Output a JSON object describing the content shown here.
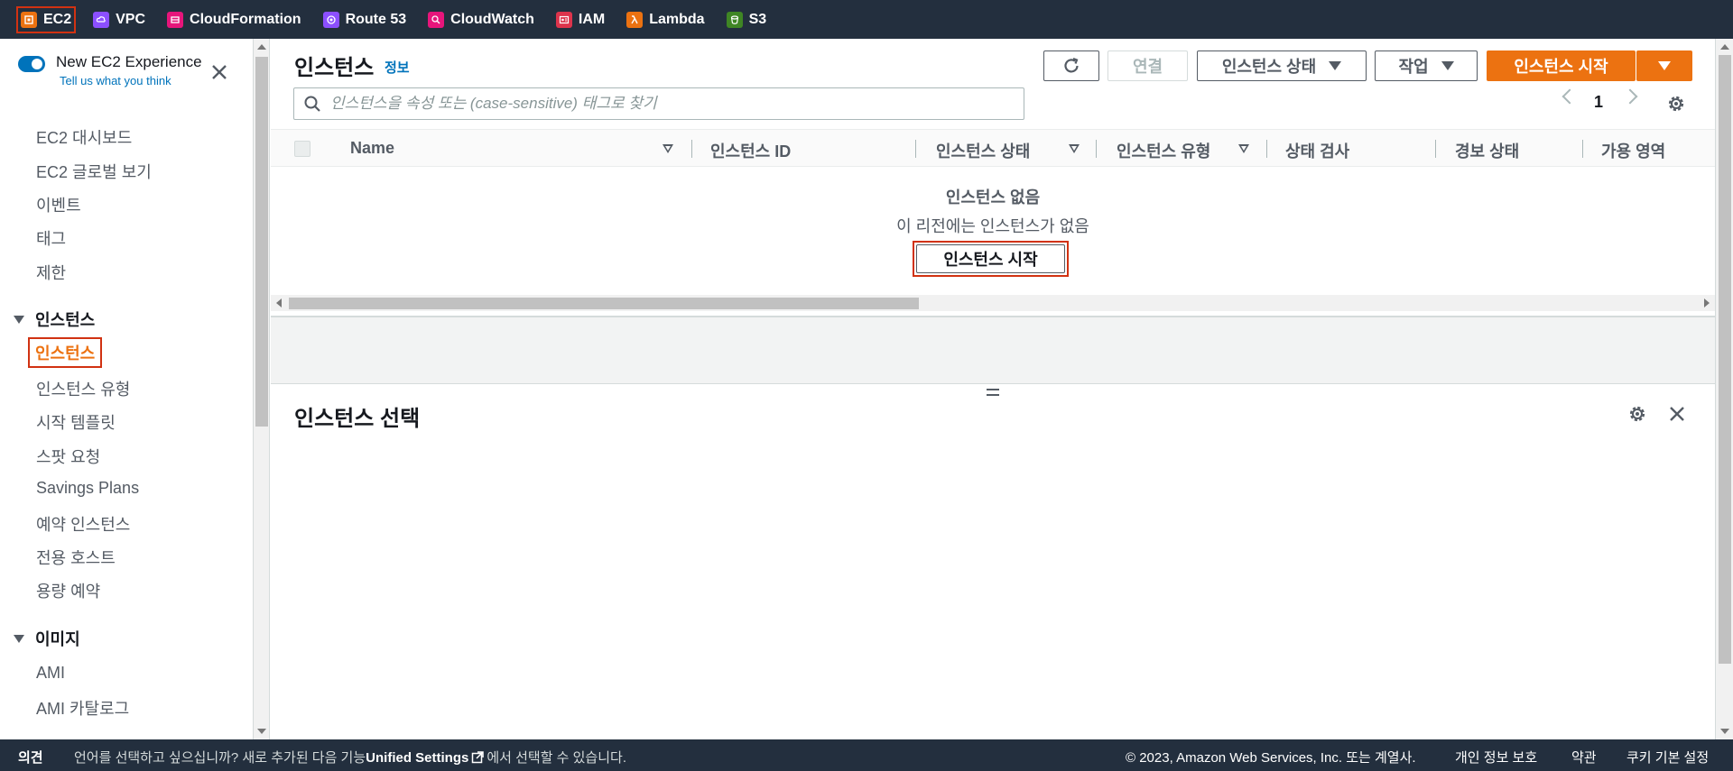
{
  "services": [
    {
      "label": "EC2",
      "icon": "ec2-icon",
      "color": "#ec7211"
    },
    {
      "label": "VPC",
      "icon": "vpc-icon",
      "color": "#8c4fff"
    },
    {
      "label": "CloudFormation",
      "icon": "cloudformation-icon",
      "color": "#e7157b"
    },
    {
      "label": "Route 53",
      "icon": "route53-icon",
      "color": "#8c4fff"
    },
    {
      "label": "CloudWatch",
      "icon": "cloudwatch-icon",
      "color": "#e7157b"
    },
    {
      "label": "IAM",
      "icon": "iam-icon",
      "color": "#dd344c"
    },
    {
      "label": "Lambda",
      "icon": "lambda-icon",
      "color": "#ec7211"
    },
    {
      "label": "S3",
      "icon": "s3-icon",
      "color": "#3f8624"
    }
  ],
  "sidebar": {
    "experience_title": "New EC2 Experience",
    "experience_sub": "Tell us what you think",
    "items_top": [
      "EC2 대시보드",
      "EC2 글로벌 보기",
      "이벤트",
      "태그",
      "제한"
    ],
    "section_instances": "인스턴스",
    "instances_items": [
      "인스턴스",
      "인스턴스 유형",
      "시작 템플릿",
      "스팟 요청",
      "Savings Plans",
      "예약 인스턴스",
      "전용 호스트",
      "용량 예약"
    ],
    "section_images": "이미지",
    "images_items": [
      "AMI",
      "AMI 카탈로그"
    ]
  },
  "main": {
    "title": "인스턴스",
    "info": "정보",
    "connect": "연결",
    "instance_state": "인스턴스 상태",
    "actions": "작업",
    "launch": "인스턴스 시작",
    "search_placeholder": "인스턴스을 속성 또는 (case-sensitive) 태그로 찾기",
    "page": "1",
    "columns": [
      "Name",
      "인스턴스 ID",
      "인스턴스 상태",
      "인스턴스 유형",
      "상태 검사",
      "경보 상태",
      "가용 영역"
    ],
    "empty_title": "인스턴스 없음",
    "empty_sub": "이 리전에는 인스턴스가 없음",
    "empty_launch": "인스턴스 시작",
    "detail_title": "인스턴스 선택"
  },
  "footer": {
    "feedback": "의견",
    "lang_prefix": "언어를 선택하고 싶으십니까? 새로 추가된 다음 기능",
    "unified": "Unified Settings",
    "lang_suffix": "에서 선택할 수 있습니다.",
    "copyright": "© 2023, Amazon Web Services, Inc. 또는 계열사.",
    "privacy": "개인 정보 보호",
    "terms": "약관",
    "cookies": "쿠키 기본 설정"
  }
}
